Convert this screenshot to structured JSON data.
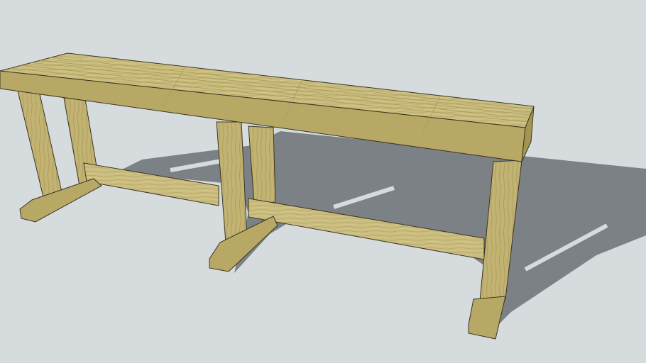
{
  "colors": {
    "background": "#d6dbde",
    "shadow": "#7c8185",
    "wood_top": "#cbbd7e",
    "wood_front": "#b8a866",
    "wood_side": "#a49550",
    "edge": "#3a3520"
  }
}
